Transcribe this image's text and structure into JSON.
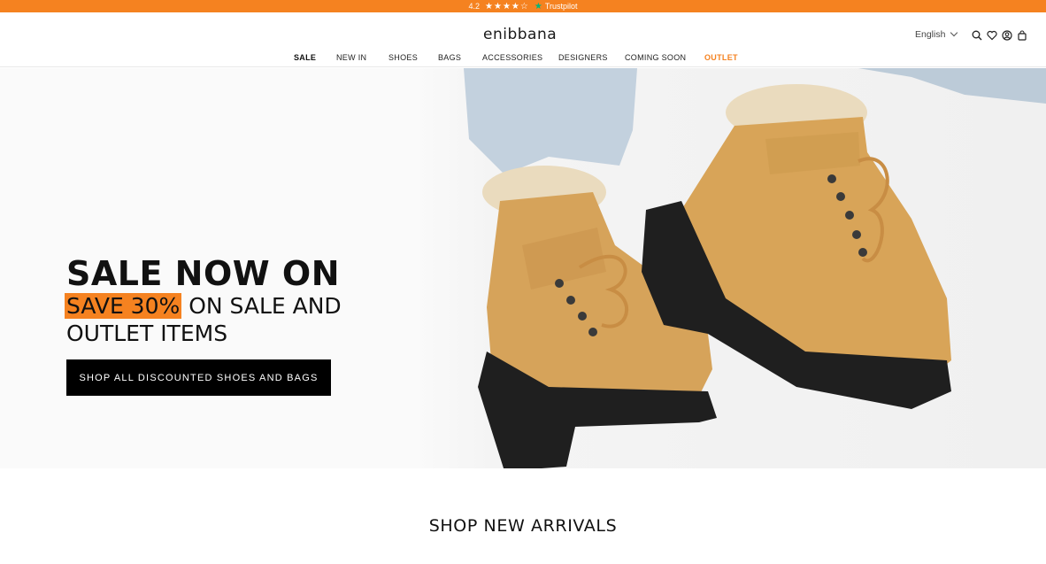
{
  "topbar": {
    "rating": "4.2",
    "stars": "★★★★☆",
    "brand": "Trustpilot"
  },
  "header": {
    "logo": "enibbana",
    "language": "English"
  },
  "nav": {
    "items": [
      "SALE",
      "NEW IN",
      "SHOES",
      "BAGS",
      "ACCESSORIES",
      "DESIGNERS",
      "COMING SOON",
      "OUTLET"
    ]
  },
  "hero": {
    "title": "SALE NOW ON",
    "highlight": "SAVE 30%",
    "subtitle_rest": " ON SALE AND OUTLET ITEMS",
    "button": "SHOP ALL DISCOUNTED SHOES AND BAGS"
  },
  "section": {
    "title": "SHOP NEW ARRIVALS"
  },
  "colors": {
    "accent": "#f58220",
    "trustpilot_green": "#00b67a",
    "boot": "#d8a458",
    "sole": "#1e1e1e",
    "denim": "#b9c8d6",
    "fur": "#ead9bd"
  },
  "icons": [
    "search-icon",
    "heart-icon",
    "account-icon",
    "bag-icon",
    "chevron-down-icon",
    "trustpilot-star-icon"
  ]
}
